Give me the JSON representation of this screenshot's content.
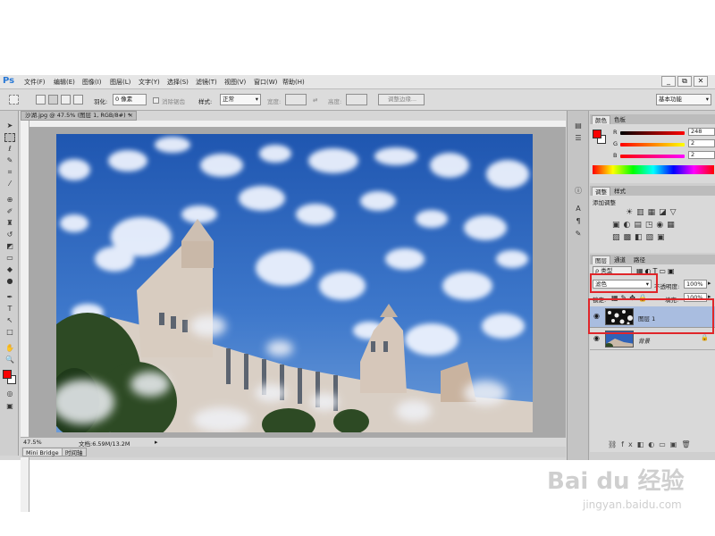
{
  "app": {
    "logo": "Ps",
    "menus": [
      "文件(F)",
      "编辑(E)",
      "图像(I)",
      "图层(L)",
      "文字(Y)",
      "选择(S)",
      "滤镜(T)",
      "视图(V)",
      "窗口(W)",
      "帮助(H)"
    ],
    "window_buttons": [
      "_",
      "⧉",
      "✕"
    ]
  },
  "options_bar": {
    "feather_label": "羽化:",
    "feather_value": "0 像素",
    "antialias_label": "消除锯齿",
    "style_label": "样式:",
    "style_value": "正常",
    "width_label": "宽度:",
    "height_label": "高度:",
    "refine_edge_button": "调整边缘...",
    "workspace_value": "基本功能"
  },
  "document": {
    "tab_title": "沙湖.jpg @ 47.5% (图层 1, RGB/8#) *",
    "zoom": "47.5%",
    "doc_size": "文档:6.59M/13.2M"
  },
  "bottom_tabs": [
    "Mini Bridge",
    "时间轴"
  ],
  "color_panel": {
    "tabs": [
      "颜色",
      "色板"
    ],
    "channels": [
      {
        "label": "R",
        "value": "248"
      },
      {
        "label": "G",
        "value": "2"
      },
      {
        "label": "B",
        "value": "2"
      }
    ],
    "foreground_color": "#f80202"
  },
  "adjustments_panel": {
    "tabs": [
      "调整",
      "样式"
    ],
    "title": "添加调整"
  },
  "layers_panel": {
    "tabs": [
      "图层",
      "通道",
      "路径"
    ],
    "filter_label": "ρ 类型",
    "blend_mode": "滤色",
    "opacity_label": "不透明度:",
    "opacity_value": "100%",
    "lock_label": "锁定:",
    "fill_label": "填充:",
    "fill_value": "100%",
    "layers": [
      {
        "name": "图层 1",
        "selected": true
      },
      {
        "name": "背景",
        "selected": false,
        "locked": true
      }
    ]
  },
  "watermark": {
    "brand": "Bai du 经验",
    "url": "jingyan.baidu.com"
  }
}
